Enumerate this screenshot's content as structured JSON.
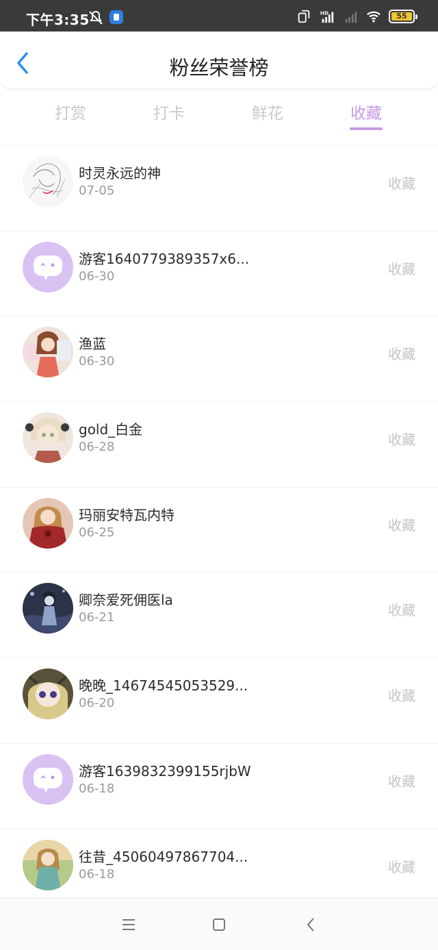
{
  "status_bar": {
    "time": "下午3:35",
    "battery": "55",
    "icons": [
      "mute-icon",
      "app-notification-icon",
      "dual-sim-icon",
      "hd-signal-icon",
      "signal-icon",
      "wifi-icon",
      "battery-icon"
    ]
  },
  "header": {
    "title": "粉丝荣誉榜",
    "back_icon": "chevron-left-icon"
  },
  "tabs": [
    {
      "label": "打赏",
      "active": false
    },
    {
      "label": "打卡",
      "active": false
    },
    {
      "label": "鲜花",
      "active": false
    },
    {
      "label": "收藏",
      "active": true
    }
  ],
  "colors": {
    "accent": "#c79ae3",
    "muted": "#c4c4c4",
    "status_bar": "#3a3a3a"
  },
  "fans": [
    {
      "name": "时灵永远的神",
      "date": "07-05",
      "action": "收藏",
      "avatar": "sketch-portrait"
    },
    {
      "name": "游客1640779389357x6...",
      "date": "06-30",
      "action": "收藏",
      "avatar": "guest-default"
    },
    {
      "name": "渔蓝",
      "date": "06-30",
      "action": "收藏",
      "avatar": "anime-girl-brown"
    },
    {
      "name": "gold_白金",
      "date": "06-28",
      "action": "收藏",
      "avatar": "anime-girl-blonde"
    },
    {
      "name": "玛丽安特瓦内特",
      "date": "06-25",
      "action": "收藏",
      "avatar": "anime-girl-red"
    },
    {
      "name": "卿奈爱死佣医la",
      "date": "06-21",
      "action": "收藏",
      "avatar": "anime-dark-blue"
    },
    {
      "name": "晚晚_14674545053529...",
      "date": "06-20",
      "action": "收藏",
      "avatar": "anime-doll-purple-eyes"
    },
    {
      "name": "游客1639832399155rjbW",
      "date": "06-18",
      "action": "收藏",
      "avatar": "guest-default"
    },
    {
      "name": "往昔_45060497867704...",
      "date": "06-18",
      "action": "收藏",
      "avatar": "anime-girl-garden"
    }
  ],
  "navbar": {
    "icons": [
      "menu-icon",
      "home-square-icon",
      "back-triangle-icon"
    ]
  }
}
